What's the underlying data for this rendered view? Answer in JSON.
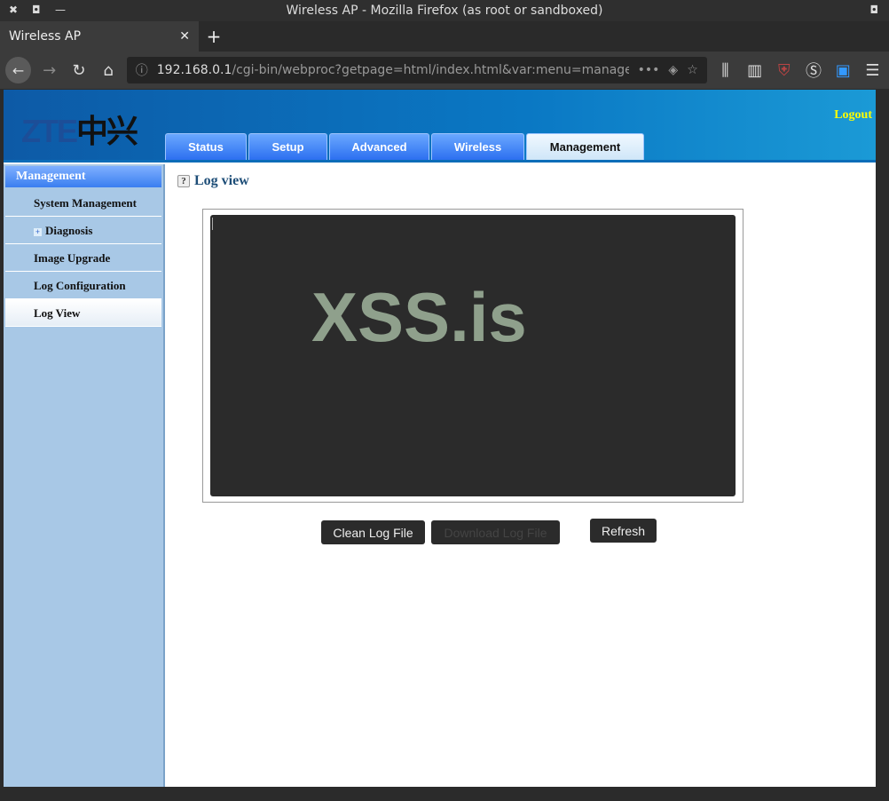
{
  "window": {
    "title": "Wireless AP - Mozilla Firefox (as root or sandboxed)"
  },
  "browser": {
    "tab_title": "Wireless AP",
    "url_host": "192.168.0.1",
    "url_path": "/cgi-bin/webproc?getpage=html/index.html&var:menu=managem"
  },
  "header": {
    "logo": "ZTE",
    "logo_cn": "中兴",
    "logout": "Logout",
    "tabs": [
      {
        "label": "Status"
      },
      {
        "label": "Setup"
      },
      {
        "label": "Advanced"
      },
      {
        "label": "Wireless"
      },
      {
        "label": "Management"
      }
    ]
  },
  "sidebar": {
    "title": "Management",
    "items": [
      {
        "label": "System Management"
      },
      {
        "label": "Diagnosis"
      },
      {
        "label": "Image Upgrade"
      },
      {
        "label": "Log Configuration"
      },
      {
        "label": "Log View"
      }
    ]
  },
  "main": {
    "title": "Log view",
    "log_content": "",
    "watermark": "XSS.is",
    "buttons": {
      "clean": "Clean Log File",
      "download": "Download Log File",
      "refresh": "Refresh"
    }
  }
}
